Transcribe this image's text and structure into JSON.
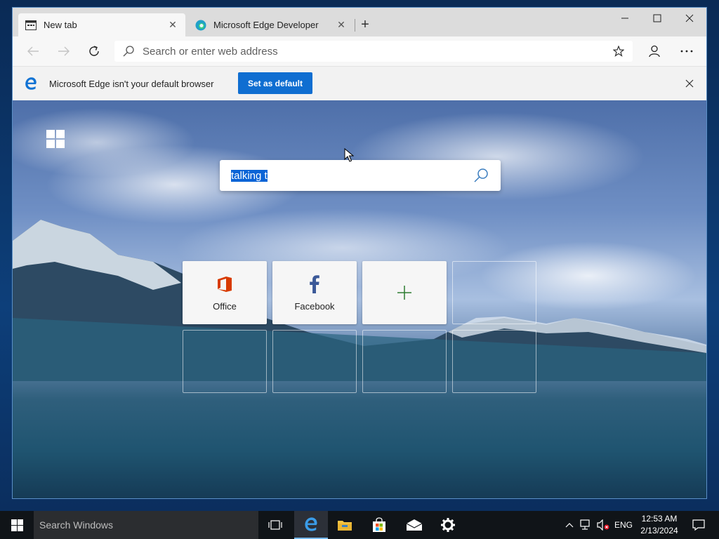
{
  "tabs": [
    {
      "title": "New tab",
      "active": true
    },
    {
      "title": "Microsoft Edge Developer",
      "active": false
    }
  ],
  "address_bar": {
    "placeholder": "Search or enter web address"
  },
  "infobar": {
    "message": "Microsoft Edge isn't your default browser",
    "button_label": "Set as default"
  },
  "ntp": {
    "search_query": "talking t",
    "top_sites": [
      {
        "label": "Office",
        "icon": "office-icon"
      },
      {
        "label": "Facebook",
        "icon": "facebook-icon"
      },
      {
        "label": "",
        "icon": "add-icon"
      }
    ]
  },
  "taskbar": {
    "search_placeholder": "Search Windows",
    "language": "ENG",
    "time": "12:53 AM",
    "date": "2/13/2024"
  },
  "colors": {
    "accent": "#0f6ed1",
    "office": "#d83b01",
    "facebook": "#3b5998",
    "add": "#2e7d32",
    "taskbar": "#101418"
  }
}
